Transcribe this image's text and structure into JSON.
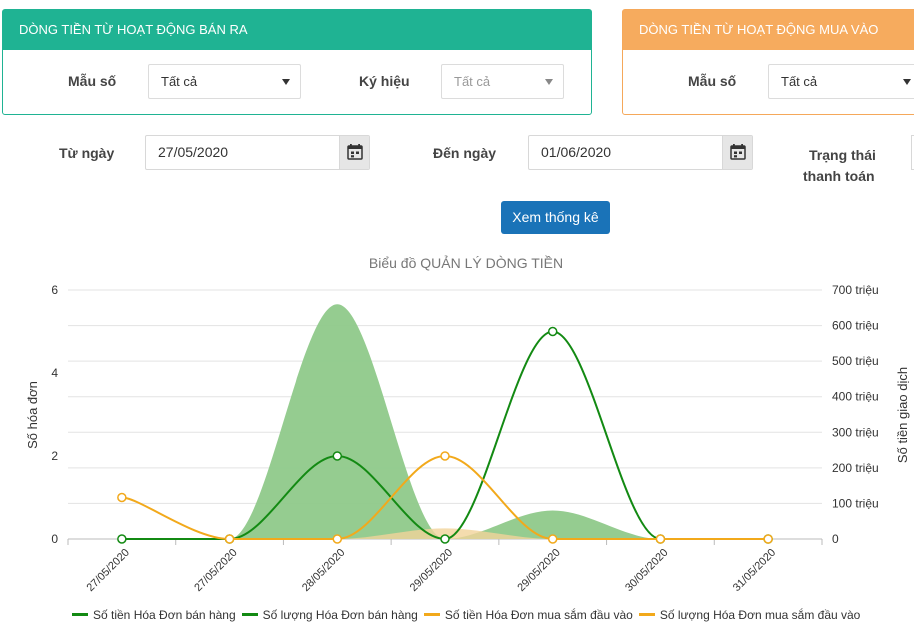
{
  "sell_panel": {
    "title": "DÒNG TIỀN TỪ HOẠT ĐỘNG BÁN RA",
    "form_label": "Mẫu số",
    "form_value": "Tất cả",
    "symbol_label": "Ký hiệu",
    "symbol_placeholder": "Tất cả"
  },
  "buy_panel": {
    "title": "DÒNG TIỀN TỪ HOẠT ĐỘNG MUA VÀO",
    "form_label": "Mẫu số",
    "form_value": "Tất cả"
  },
  "filters": {
    "from_label": "Từ ngày",
    "from_value": "27/05/2020",
    "to_label": "Đến ngày",
    "to_value": "01/06/2020",
    "status_label_1": "Trạng thái",
    "status_label_2": "thanh toán"
  },
  "view_button": "Xem thống kê",
  "colors": {
    "sell_teal": "#1fb393",
    "buy_orange": "#f6ab5e",
    "green": "#138a13",
    "area_green": "#8fc98a",
    "orange": "#f2a91b",
    "button_blue": "#1a73b8"
  },
  "chart_data": {
    "type": "line",
    "title": "Biểu đồ QUẢN LÝ DÒNG TIỀN",
    "categories": [
      "27/05/2020",
      "27/05/2020",
      "28/05/2020",
      "29/05/2020",
      "29/05/2020",
      "30/05/2020",
      "31/05/2020"
    ],
    "ylabel_left": "Số hóa đơn",
    "ylabel_right": "Số tiền giao dịch",
    "ylim_left": [
      0,
      6
    ],
    "left_ticks": [
      "0",
      "2",
      "4",
      "6"
    ],
    "ylim_right": [
      0,
      700
    ],
    "right_ticks": [
      "0",
      "100 triệu",
      "200 triệu",
      "300 triệu",
      "400 triệu",
      "500 triệu",
      "600 triệu",
      "700 triệu"
    ],
    "grid": true,
    "legend_position": "bottom",
    "series": [
      {
        "name": "Số tiền Hóa Đơn bán hàng",
        "axis": "right",
        "kind": "area",
        "values": [
          0,
          0,
          660,
          0,
          80,
          0,
          0
        ]
      },
      {
        "name": "Số lượng Hóa Đơn bán hàng",
        "axis": "left",
        "kind": "line",
        "values": [
          0,
          0,
          2,
          0,
          5,
          0,
          0
        ]
      },
      {
        "name": "Số tiền Hóa Đơn mua sắm đầu vào",
        "axis": "right",
        "kind": "area",
        "values": [
          0,
          0,
          0,
          30,
          0,
          0,
          0
        ]
      },
      {
        "name": "Số lượng Hóa Đơn mua sắm đầu vào",
        "axis": "left",
        "kind": "line",
        "values": [
          1,
          0,
          0,
          2,
          0,
          0,
          0
        ]
      }
    ]
  }
}
